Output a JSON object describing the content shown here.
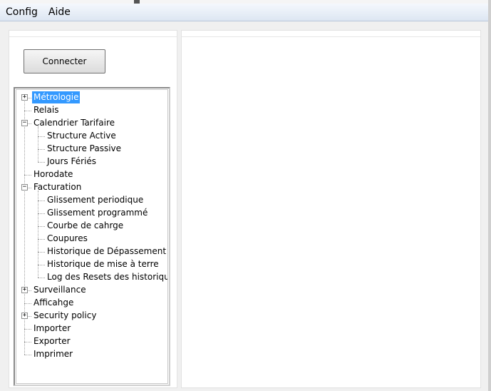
{
  "menubar": {
    "items": [
      "Config",
      "Aide"
    ]
  },
  "toolbar": {
    "connect_label": "Connecter"
  },
  "tree": {
    "items": [
      {
        "label": "Métrologie",
        "level": 0,
        "expander": "+",
        "selected": true
      },
      {
        "label": "Relais",
        "level": 0
      },
      {
        "label": "Calendrier Tarifaire",
        "level": 0,
        "expander": "-"
      },
      {
        "label": "Structure Active",
        "level": 1
      },
      {
        "label": "Structure Passive",
        "level": 1
      },
      {
        "label": "Jours Fériés",
        "level": 1
      },
      {
        "label": "Horodate",
        "level": 0
      },
      {
        "label": "Facturation",
        "level": 0,
        "expander": "-"
      },
      {
        "label": "Glissement periodique",
        "level": 1
      },
      {
        "label": "Glissement programmé",
        "level": 1
      },
      {
        "label": "Courbe de cahrge",
        "level": 1
      },
      {
        "label": "Coupures",
        "level": 1
      },
      {
        "label": "Historique de Dépassement de",
        "level": 1
      },
      {
        "label": "Historique de mise à terre",
        "level": 1
      },
      {
        "label": "Log des Resets des historiques",
        "level": 1
      },
      {
        "label": "Surveillance",
        "level": 0,
        "expander": "+"
      },
      {
        "label": "Afficahge",
        "level": 0
      },
      {
        "label": "Security policy",
        "level": 0,
        "expander": "+"
      },
      {
        "label": "Importer",
        "level": 0
      },
      {
        "label": "Exporter",
        "level": 0
      },
      {
        "label": "Imprimer",
        "level": 0
      }
    ]
  },
  "colors": {
    "selection": "#3399ff",
    "menubar": "#dde6f2"
  }
}
